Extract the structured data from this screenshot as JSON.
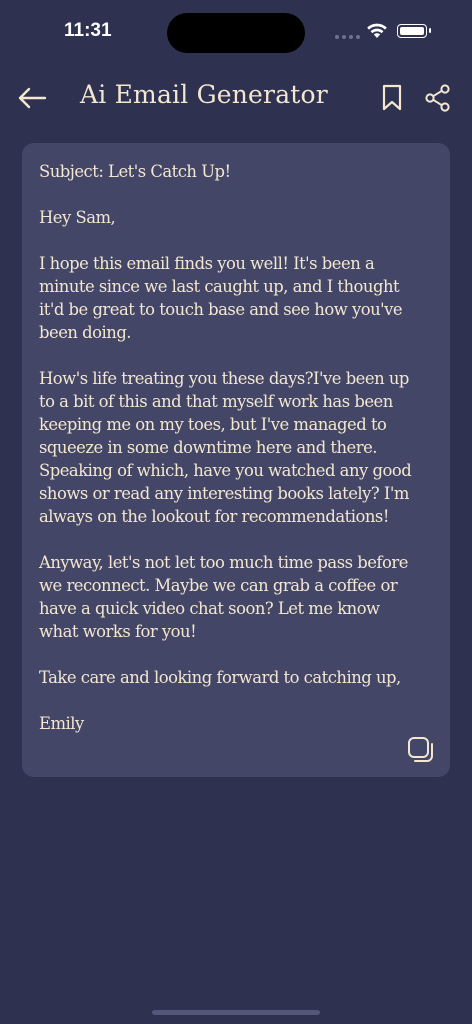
{
  "status_bar": {
    "time": "11:31"
  },
  "header": {
    "title": "Ai Email Generator"
  },
  "email": {
    "body": "Subject: Let's Catch Up!\n\nHey Sam,\n\nI hope this email finds you well! It's been a\nminute since we last caught up, and I thought\nit'd be great to touch base and see how you've\nbeen doing.\n\nHow's life treating you these days?I've been up\nto a bit of this and that myself work has been\nkeeping me on my toes, but I've managed to\nsqueeze in some downtime here and there.\nSpeaking of which, have you watched any good\nshows or read any interesting books lately? I'm\nalways on the lookout for recommendations!\n\nAnyway, let's not let too much time pass before\nwe reconnect. Maybe we can grab a coffee or\nhave a quick video chat soon? Let me know\nwhat works for you!\n\nTake care and looking forward to catching up,\n\nEmily"
  },
  "icons": {
    "back": "arrow-left-icon",
    "bookmark": "bookmark-icon",
    "share": "share-icon",
    "copy": "copy-icon"
  },
  "colors": {
    "background": "#2f3150",
    "card": "#444667",
    "text": "#f3e7cf"
  }
}
